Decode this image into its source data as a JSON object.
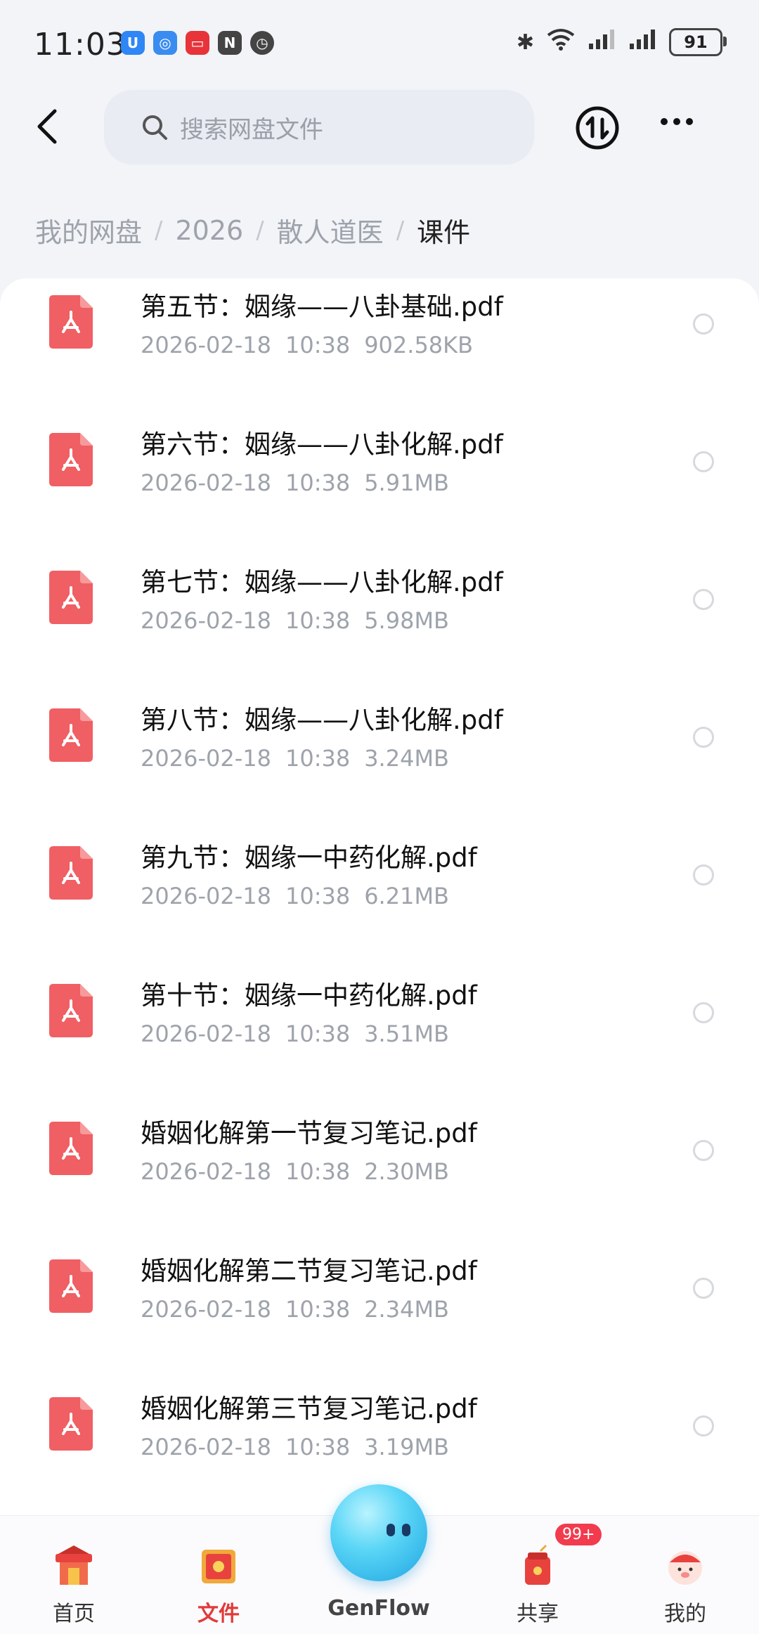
{
  "status_bar": {
    "time": "11:03",
    "battery": "91",
    "app_icons": [
      "shield-app-icon",
      "browser-icon",
      "video-app-icon",
      "nfc-icon",
      "alarm-icon"
    ]
  },
  "topbar": {
    "search_placeholder": "搜索网盘文件"
  },
  "breadcrumb": [
    {
      "label": "我的网盘"
    },
    {
      "label": "2026"
    },
    {
      "label": "散人道医"
    },
    {
      "label": "课件"
    }
  ],
  "files": [
    {
      "name": "第五节：姻缘——八卦基础.pdf",
      "date": "2026-02-18",
      "time": "10:38",
      "size": "902.58KB"
    },
    {
      "name": "第六节：姻缘——八卦化解.pdf",
      "date": "2026-02-18",
      "time": "10:38",
      "size": "5.91MB"
    },
    {
      "name": "第七节：姻缘——八卦化解.pdf",
      "date": "2026-02-18",
      "time": "10:38",
      "size": "5.98MB"
    },
    {
      "name": "第八节：姻缘——八卦化解.pdf",
      "date": "2026-02-18",
      "time": "10:38",
      "size": "3.24MB"
    },
    {
      "name": "第九节：姻缘一中药化解.pdf",
      "date": "2026-02-18",
      "time": "10:38",
      "size": "6.21MB"
    },
    {
      "name": "第十节：姻缘一中药化解.pdf",
      "date": "2026-02-18",
      "time": "10:38",
      "size": "3.51MB"
    },
    {
      "name": "婚姻化解第一节复习笔记.pdf",
      "date": "2026-02-18",
      "time": "10:38",
      "size": "2.30MB"
    },
    {
      "name": "婚姻化解第二节复习笔记.pdf",
      "date": "2026-02-18",
      "time": "10:38",
      "size": "2.34MB"
    },
    {
      "name": "婚姻化解第三节复习笔记.pdf",
      "date": "2026-02-18",
      "time": "10:38",
      "size": "3.19MB"
    }
  ],
  "bottom_nav": {
    "home": "首页",
    "files": "文件",
    "genflow": "GenFlow",
    "share": "共享",
    "mine": "我的",
    "share_badge": "99+",
    "active": "files"
  },
  "colors": {
    "pdf": "#ef5f63",
    "accent_red": "#e23a3a",
    "badge": "#f23b4e"
  }
}
